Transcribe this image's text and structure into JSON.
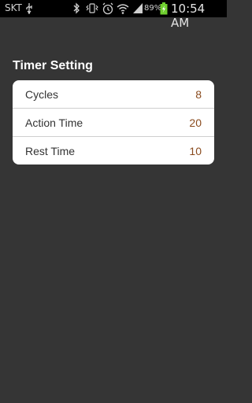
{
  "status_bar": {
    "carrier": "SKT",
    "battery_percent": "89%",
    "time": "10:54 AM",
    "icons": [
      "usb-icon",
      "bluetooth-icon",
      "vibrate-icon",
      "alarm-icon",
      "wifi-icon",
      "signal-icon",
      "battery-charging-icon"
    ]
  },
  "timer_setting": {
    "title": "Timer Setting",
    "rows": [
      {
        "label": "Cycles",
        "value": "8"
      },
      {
        "label": "Action Time",
        "value": "20"
      },
      {
        "label": "Rest Time",
        "value": "10"
      }
    ]
  },
  "colors": {
    "background": "#353535",
    "card": "#ffffff",
    "value_accent": "#8a4b1e",
    "battery_green": "#6fcf2f"
  }
}
